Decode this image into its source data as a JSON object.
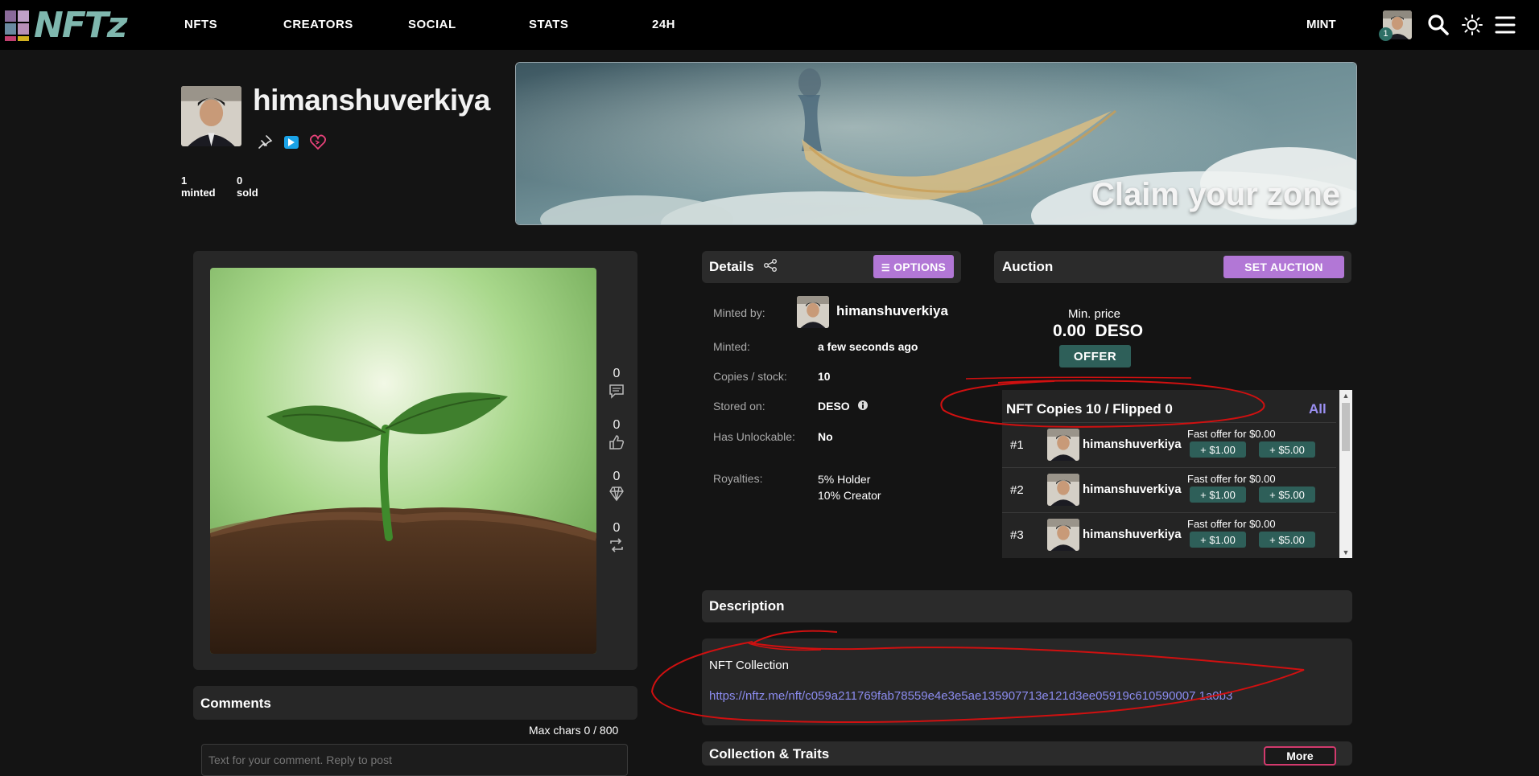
{
  "nav": {
    "logo_text": "NFTz",
    "links": [
      "NFTS",
      "CREATORS",
      "SOCIAL",
      "STATS",
      "24H"
    ],
    "mint": "MINT",
    "notification_count": "1",
    "icons": [
      "search-icon",
      "sun-icon",
      "hamburger-menu-icon"
    ]
  },
  "profile": {
    "username": "himanshuverkiya",
    "minted_count": "1",
    "minted_label": "minted",
    "sold_count": "0",
    "sold_label": "sold",
    "icons": [
      "pin-icon",
      "arrow-badge-icon",
      "heart-icon"
    ]
  },
  "banner": {
    "text": "Claim your zone"
  },
  "media": {
    "comments_count": "0",
    "likes_count": "0",
    "diamonds_count": "0",
    "reposts_count": "0"
  },
  "comments": {
    "title": "Comments",
    "max_chars": "Max chars 0 / 800",
    "placeholder": "Text for your comment. Reply to post"
  },
  "details": {
    "title": "Details",
    "options_label": "OPTIONS",
    "minted_by_label": "Minted by:",
    "minted_by": "himanshuverkiya",
    "minted_label": "Minted:",
    "minted_value": "a few seconds ago",
    "copies_label": "Copies / stock:",
    "copies_value": "10",
    "stored_label": "Stored on:",
    "stored_value": "DESO",
    "unlockable_label": "Has Unlockable:",
    "unlockable_value": "No",
    "royalties_label": "Royalties:",
    "royalties_holder": "5% Holder",
    "royalties_creator": "10% Creator"
  },
  "auction": {
    "title": "Auction",
    "set_auction_label": "SET AUCTION",
    "min_price_label": "Min. price",
    "min_price_value": "0.00  DESO",
    "offer_label": "OFFER"
  },
  "copies": {
    "title": "NFT Copies 10 / Flipped 0",
    "all_label": "All",
    "rows": [
      {
        "num": "#1",
        "owner": "himanshuverkiya",
        "fast_offer": "Fast offer for $0.00",
        "btn1": "+ $1.00",
        "btn2": "+ $5.00"
      },
      {
        "num": "#2",
        "owner": "himanshuverkiya",
        "fast_offer": "Fast offer for $0.00",
        "btn1": "+ $1.00",
        "btn2": "+ $5.00"
      },
      {
        "num": "#3",
        "owner": "himanshuverkiya",
        "fast_offer": "Fast offer for $0.00",
        "btn1": "+ $1.00",
        "btn2": "+ $5.00"
      }
    ]
  },
  "description": {
    "title": "Description",
    "text": "NFT Collection",
    "link": "https://nftz.me/nft/c059a211769fab78559e4e3e5ae135907713e121d3ee05919c610590007 1a0b3"
  },
  "traits": {
    "title": "Collection & Traits",
    "more_label": "More"
  },
  "colors": {
    "accent_purple": "#b277d6",
    "teal_button": "#2e5f59",
    "link": "#8c8cf0",
    "annotation_red": "#d01010"
  }
}
